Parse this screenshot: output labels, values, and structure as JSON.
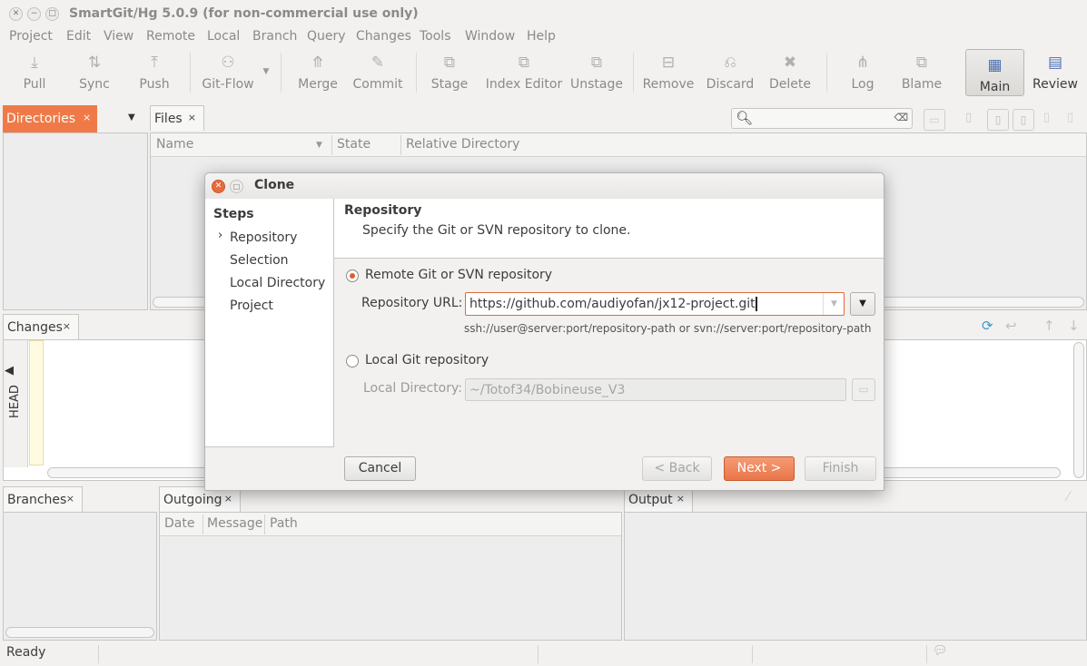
{
  "window": {
    "title": "SmartGit/Hg 5.0.9 (for non-commercial use only)"
  },
  "menu": [
    "Project",
    "Edit",
    "View",
    "Remote",
    "Local",
    "Branch",
    "Query",
    "Changes",
    "Tools",
    "Window",
    "Help"
  ],
  "toolbar": {
    "pull": "Pull",
    "sync": "Sync",
    "push": "Push",
    "gitflow": "Git-Flow",
    "merge": "Merge",
    "commit": "Commit",
    "stage": "Stage",
    "index_editor": "Index Editor",
    "unstage": "Unstage",
    "remove": "Remove",
    "discard": "Discard",
    "delete": "Delete",
    "log": "Log",
    "blame": "Blame",
    "main": "Main",
    "review": "Review"
  },
  "directories": {
    "tab": "Directories",
    "close": "×"
  },
  "files": {
    "tab": "Files",
    "close": "×",
    "columns": [
      "Name",
      "State",
      "Relative Directory"
    ]
  },
  "changes": {
    "tab": "Changes",
    "close": "×",
    "head": "HEAD"
  },
  "branches": {
    "tab": "Branches",
    "close": "×"
  },
  "outgoing": {
    "tab": "Outgoing",
    "close": "×",
    "columns": [
      "Date",
      "Message",
      "Path"
    ]
  },
  "output": {
    "tab": "Output",
    "close": "×"
  },
  "status": {
    "text": "Ready"
  },
  "dialog": {
    "title": "Clone",
    "steps_header": "Steps",
    "steps": [
      "Repository",
      "Selection",
      "Local Directory",
      "Project"
    ],
    "current_step_marker": "›",
    "section_title": "Repository",
    "section_desc": "Specify the Git or SVN repository to clone.",
    "remote_option": "Remote Git or SVN repository",
    "url_label": "Repository URL:",
    "url_value": "https://github.com/audiyofan/jx12-project.git",
    "url_hint": "ssh://user@server:port/repository-path or svn://server:port/repository-path",
    "local_option": "Local Git repository",
    "local_dir_label": "Local Directory:",
    "local_dir_value": "~/Totof34/Bobineuse_V3",
    "cancel": "Cancel",
    "back": "< Back",
    "next": "Next >",
    "finish": "Finish"
  }
}
